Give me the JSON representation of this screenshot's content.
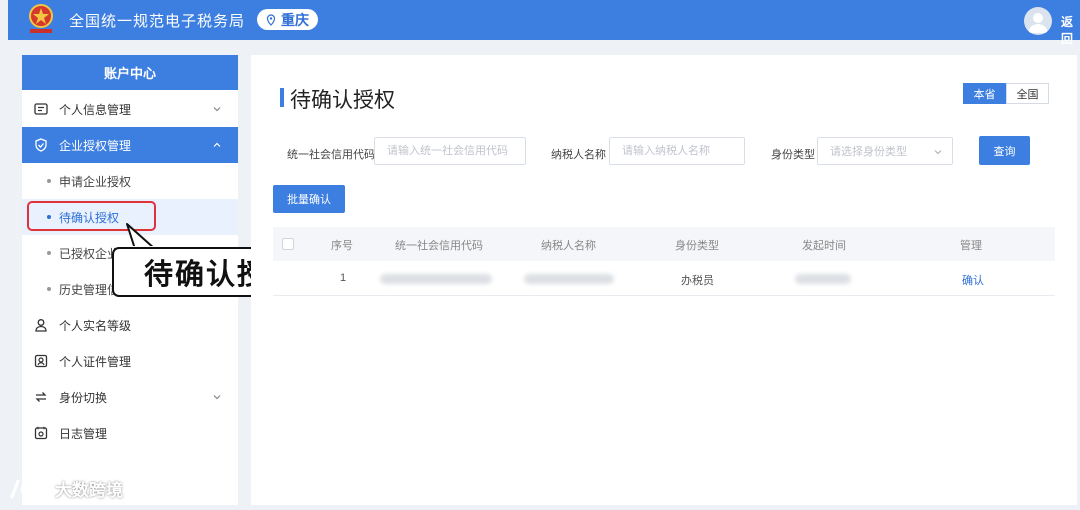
{
  "header": {
    "app_title": "全国统一规范电子税务局",
    "region": "重庆",
    "back_label": "返回"
  },
  "sidebar": {
    "title": "账户中心",
    "items": [
      {
        "label": "个人信息管理",
        "icon": "id-card-icon"
      },
      {
        "label": "企业授权管理",
        "icon": "shield-check-icon"
      },
      {
        "label": "个人实名等级",
        "icon": "user-level-icon"
      },
      {
        "label": "个人证件管理",
        "icon": "certificate-icon"
      },
      {
        "label": "身份切换",
        "icon": "switch-icon"
      },
      {
        "label": "日志管理",
        "icon": "log-icon"
      }
    ],
    "sub_items": [
      {
        "label": "申请企业授权"
      },
      {
        "label": "待确认授权"
      },
      {
        "label": "已授权企业"
      },
      {
        "label": "历史管理信"
      }
    ]
  },
  "callout": {
    "text": "待确认授权"
  },
  "main": {
    "title": "待确认授权",
    "scope": [
      "本省",
      "全国"
    ],
    "filters": {
      "credit_code_label": "统一社会信用代码",
      "credit_code_placeholder": "请输入统一社会信用代码",
      "taxpayer_label": "纳税人名称",
      "taxpayer_placeholder": "请输入纳税人名称",
      "identity_label": "身份类型",
      "identity_placeholder": "请选择身份类型",
      "query_label": "查询"
    },
    "batch_confirm_label": "批量确认",
    "table": {
      "headers": [
        "序号",
        "统一社会信用代码",
        "纳税人名称",
        "身份类型",
        "发起时间",
        "管理"
      ],
      "rows": [
        {
          "index": "1",
          "identity": "办税员",
          "action": "确认"
        }
      ]
    }
  },
  "watermark": {
    "text": "大数跨境"
  },
  "colors": {
    "primary": "#3d7fe0",
    "highlight": "#e0323a",
    "link": "#2f6fd6"
  }
}
